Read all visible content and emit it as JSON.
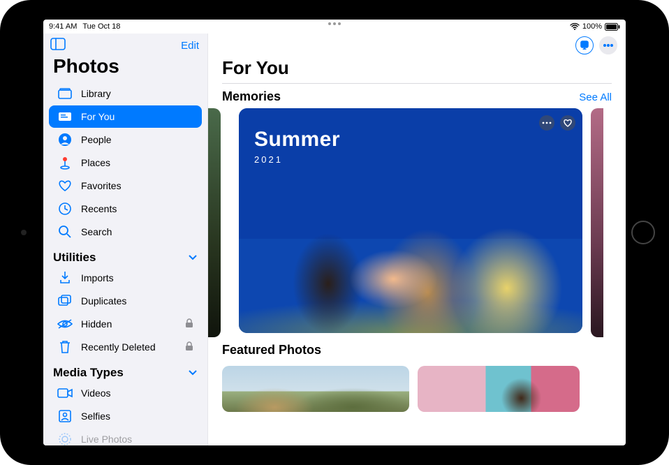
{
  "status": {
    "time": "9:41 AM",
    "date": "Tue Oct 18",
    "battery": "100%"
  },
  "sidebar": {
    "edit": "Edit",
    "title": "Photos",
    "items": [
      {
        "label": "Library"
      },
      {
        "label": "For You"
      },
      {
        "label": "People"
      },
      {
        "label": "Places"
      },
      {
        "label": "Favorites"
      },
      {
        "label": "Recents"
      },
      {
        "label": "Search"
      }
    ],
    "utilities_header": "Utilities",
    "utilities": [
      {
        "label": "Imports"
      },
      {
        "label": "Duplicates"
      },
      {
        "label": "Hidden"
      },
      {
        "label": "Recently Deleted"
      }
    ],
    "media_header": "Media Types",
    "media": [
      {
        "label": "Videos"
      },
      {
        "label": "Selfies"
      },
      {
        "label": "Live Photos"
      }
    ]
  },
  "main": {
    "title": "For You",
    "memories_header": "Memories",
    "see_all": "See All",
    "memory_title": "Summer",
    "memory_subtitle": "2021",
    "featured_header": "Featured Photos"
  }
}
